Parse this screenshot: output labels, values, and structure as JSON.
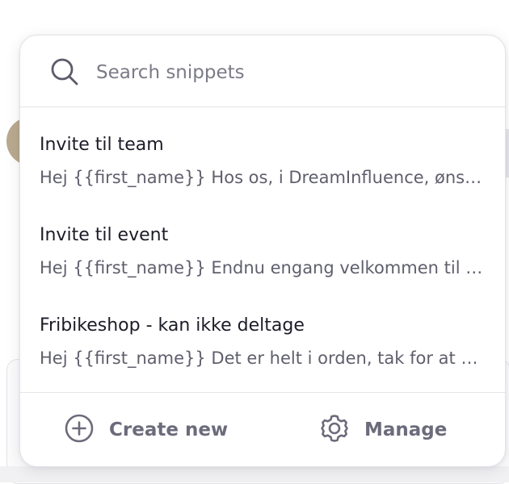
{
  "search": {
    "placeholder": "Search snippets",
    "value": ""
  },
  "snippets": [
    {
      "title": "Invite til team",
      "preview": "Hej {{first_name}} Hos os, i DreamInfluence, ønsker vi at byde dig velkommen til teamet"
    },
    {
      "title": "Invite til event",
      "preview": "Hej {{first_name}} Endnu engang velkommen til vores event"
    },
    {
      "title": "Fribikeshop - kan ikke deltage",
      "preview": "Hej {{first_name}} Det er helt i orden, tak for at give besked"
    }
  ],
  "footer": {
    "create_label": "Create new",
    "manage_label": "Manage",
    "create_icon": "plus-circle-icon",
    "manage_icon": "gear-icon"
  },
  "colors": {
    "title_text": "#1c1c28",
    "preview_text": "#5f5f6d",
    "footer_text": "#6b6b7b",
    "divider": "#e4e4ea"
  }
}
